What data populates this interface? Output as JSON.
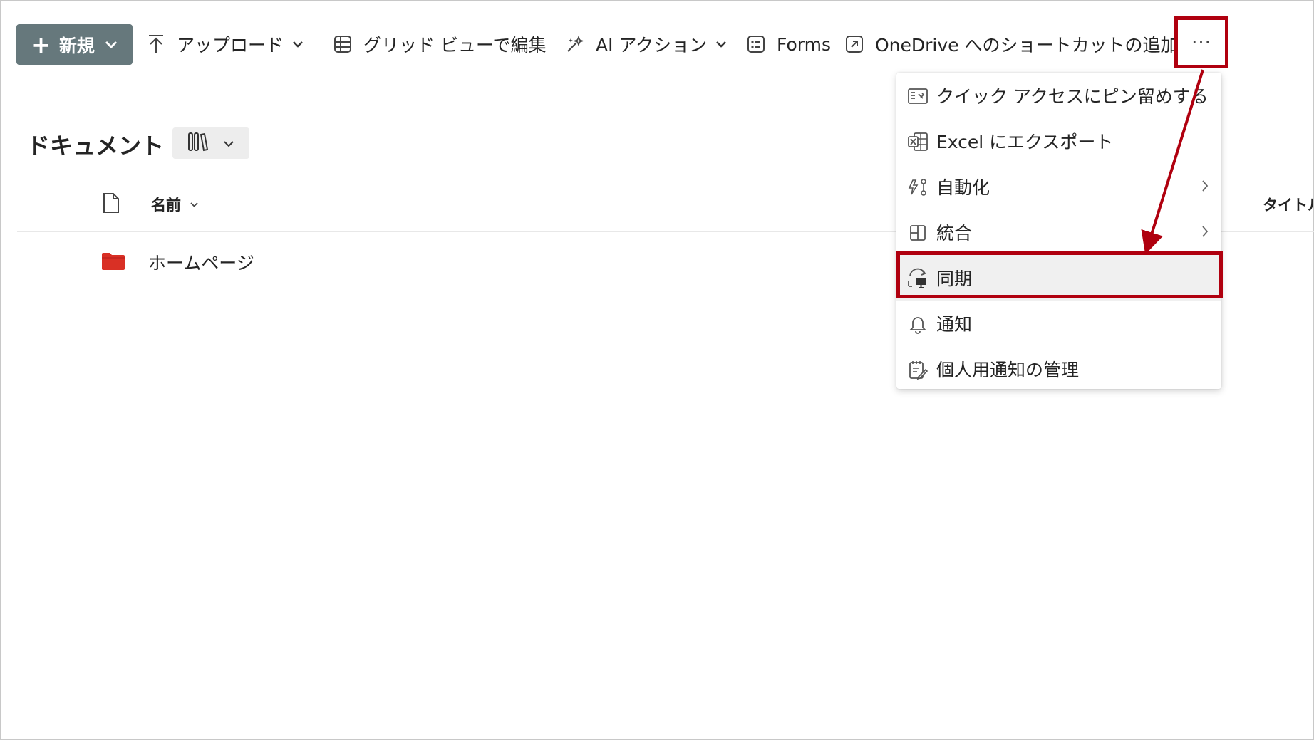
{
  "toolbar": {
    "new_label": "新規",
    "upload_label": "アップロード",
    "grid_edit_label": "グリッド ビューで編集",
    "ai_action_label": "AI アクション",
    "forms_label": "Forms",
    "onedrive_shortcut_label": "OneDrive へのショートカットの追加",
    "more_label": "···"
  },
  "page": {
    "title": "ドキュメント"
  },
  "list": {
    "columns": {
      "name": "名前",
      "title": "タイトル"
    },
    "rows": [
      {
        "name": "ホームページ"
      }
    ]
  },
  "menu": {
    "items": [
      {
        "label": "クイック アクセスにピン留めする"
      },
      {
        "label": "Excel にエクスポート"
      },
      {
        "label": "自動化"
      },
      {
        "label": "統合"
      },
      {
        "label": "同期"
      },
      {
        "label": "通知"
      },
      {
        "label": "個人用通知の管理"
      }
    ]
  },
  "colors": {
    "new_button_bg": "#66787c",
    "highlight_border": "#b0000f",
    "folder": "#d93025"
  }
}
